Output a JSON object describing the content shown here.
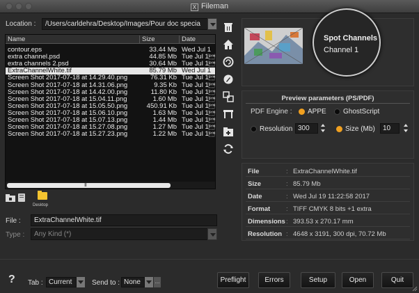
{
  "window": {
    "title": "Fileman"
  },
  "location": {
    "label": "Location",
    "path": "/Users/carldehra/Desktop/Images/Pour doc specia"
  },
  "file_list": {
    "columns": [
      "Name",
      "Size",
      "Date"
    ],
    "rows": [
      {
        "name": "contour.eps",
        "size": "33.44 Mb",
        "date": "Wed Jul 1"
      },
      {
        "name": "extra channel.psd",
        "size": "44.85 Mb",
        "date": "Tue Jul 1\u0016"
      },
      {
        "name": "extra channels 2.psd",
        "size": "30.64 Mb",
        "date": "Tue Jul 1\u0016"
      },
      {
        "name": "ExtraChannelWhite.tif",
        "size": "85.79 Mb",
        "date": "Wed Jul 1",
        "selected": true
      },
      {
        "name": "Screen Shot 2017-07-18 at 14.29.40.png",
        "size": "76.31 Kb",
        "date": "Tue Jul 1\u0016"
      },
      {
        "name": "Screen Shot 2017-07-18 at 14.31.06.png",
        "size": "9.35 Kb",
        "date": "Tue Jul 1\u0016"
      },
      {
        "name": "Screen Shot 2017-07-18 at 14.42.00.png",
        "size": "11.80 Kb",
        "date": "Tue Jul 1\u0016"
      },
      {
        "name": "Screen Shot 2017-07-18 at 15.04.11.png",
        "size": "1.60 Mb",
        "date": "Tue Jul 1\u0016"
      },
      {
        "name": "Screen Shot 2017-07-18 at 15.05.50.png",
        "size": "450.91 Kb",
        "date": "Tue Jul 1\u0016"
      },
      {
        "name": "Screen Shot 2017-07-18 at 15.06.10.png",
        "size": "1.63 Mb",
        "date": "Tue Jul 1\u0016"
      },
      {
        "name": "Screen Shot 2017-07-18 at 15.07.13.png",
        "size": "1.44 Mb",
        "date": "Tue Jul 1\u0016"
      },
      {
        "name": "Screen Shot 2017-07-18 at 15.27.08.png",
        "size": "1.27 Mb",
        "date": "Tue Jul 1\u0016"
      },
      {
        "name": "Screen Shot 2017-07-18 at 15.27.23.png",
        "size": "1.22 Mb",
        "date": "Tue Jul 1\u0016"
      }
    ],
    "scroll_grip": "III"
  },
  "favorites": {
    "desktop_label": "Desktop"
  },
  "file_field": {
    "label": "File",
    "value": "ExtraChannelWhite.tif"
  },
  "type_field": {
    "label": "Type",
    "value": "Any Kind (*)"
  },
  "preview": {
    "title": "Spot Channels",
    "channel": "Channel 1"
  },
  "params": {
    "title": "Preview parameters (PS/PDF)",
    "engine_label": "PDF Engine",
    "engine_options": [
      "APPE",
      "GhostScript"
    ],
    "engine_selected": "APPE",
    "resolution_label": "Resolution",
    "resolution_value": "300",
    "size_label": "Size (Mb)",
    "size_value": "10",
    "mode_selected": "Size (Mb)"
  },
  "info": [
    {
      "key": "File",
      "value": "ExtraChannelWhite.tif"
    },
    {
      "key": "Size",
      "value": "85.79 Mb"
    },
    {
      "key": "Date",
      "value": "Wed Jul 19 11:22:58 2017"
    },
    {
      "key": "Format",
      "value": "TIFF CMYK 8 bits +1 extra"
    },
    {
      "key": "Dimensions",
      "value": "393.53 x 270.17 mm"
    },
    {
      "key": "Resolution",
      "value": "4648 x 3191, 300 dpi, 70.72 Mb"
    }
  ],
  "bottom": {
    "help": "?",
    "tab_label": "Tab",
    "tab_value": "Current",
    "sendto_label": "Send to",
    "sendto_value": "None",
    "sendto_more": "...",
    "buttons": [
      "Preflight",
      "Errors",
      "Setup",
      "Open",
      "Quit"
    ]
  },
  "colors": {
    "accent_radio": "#f0a020",
    "selection": "#e6e6e6",
    "folder": "#f4c430"
  }
}
